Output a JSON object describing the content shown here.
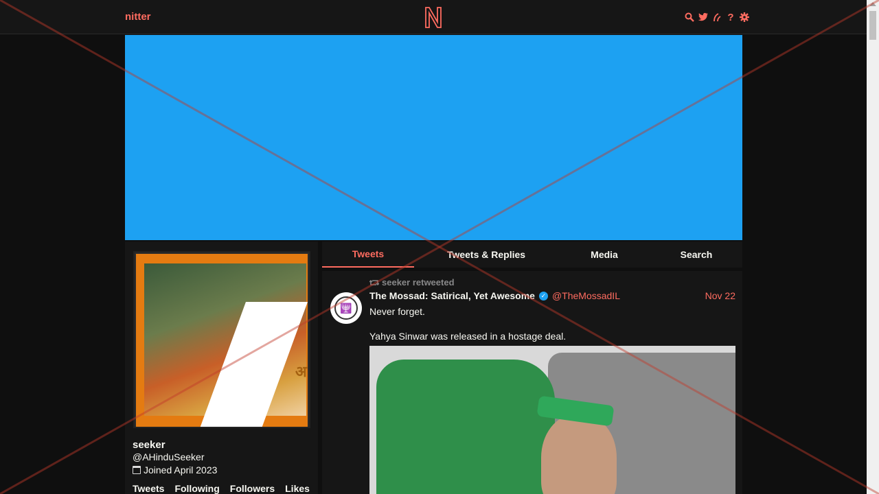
{
  "navbar": {
    "brand": "nitter",
    "icons": [
      "search-icon",
      "twitter-bird-icon",
      "rss-icon",
      "help-icon",
      "settings-gear-icon"
    ]
  },
  "colors": {
    "accent": "#ff6c60",
    "background": "#0f0f0f",
    "panel": "#161616",
    "banner": "#1da1f2"
  },
  "profile": {
    "fullname": "seeker",
    "username": "@AHinduSeeker",
    "joined": "Joined April 2023",
    "stats": [
      "Tweets",
      "Following",
      "Followers",
      "Likes"
    ]
  },
  "tabs": [
    "Tweets",
    "Tweets & Replies",
    "Media",
    "Search"
  ],
  "active_tab": "Tweets",
  "tweet": {
    "retweet_header": "seeker retweeted",
    "fullname": "The Mossad: Satirical, Yet Awesome",
    "username": "@TheMossadIL",
    "date": "Nov 22",
    "text_1": "Never forget.",
    "text_2": "Yahya Sinwar was released in a hostage deal."
  }
}
